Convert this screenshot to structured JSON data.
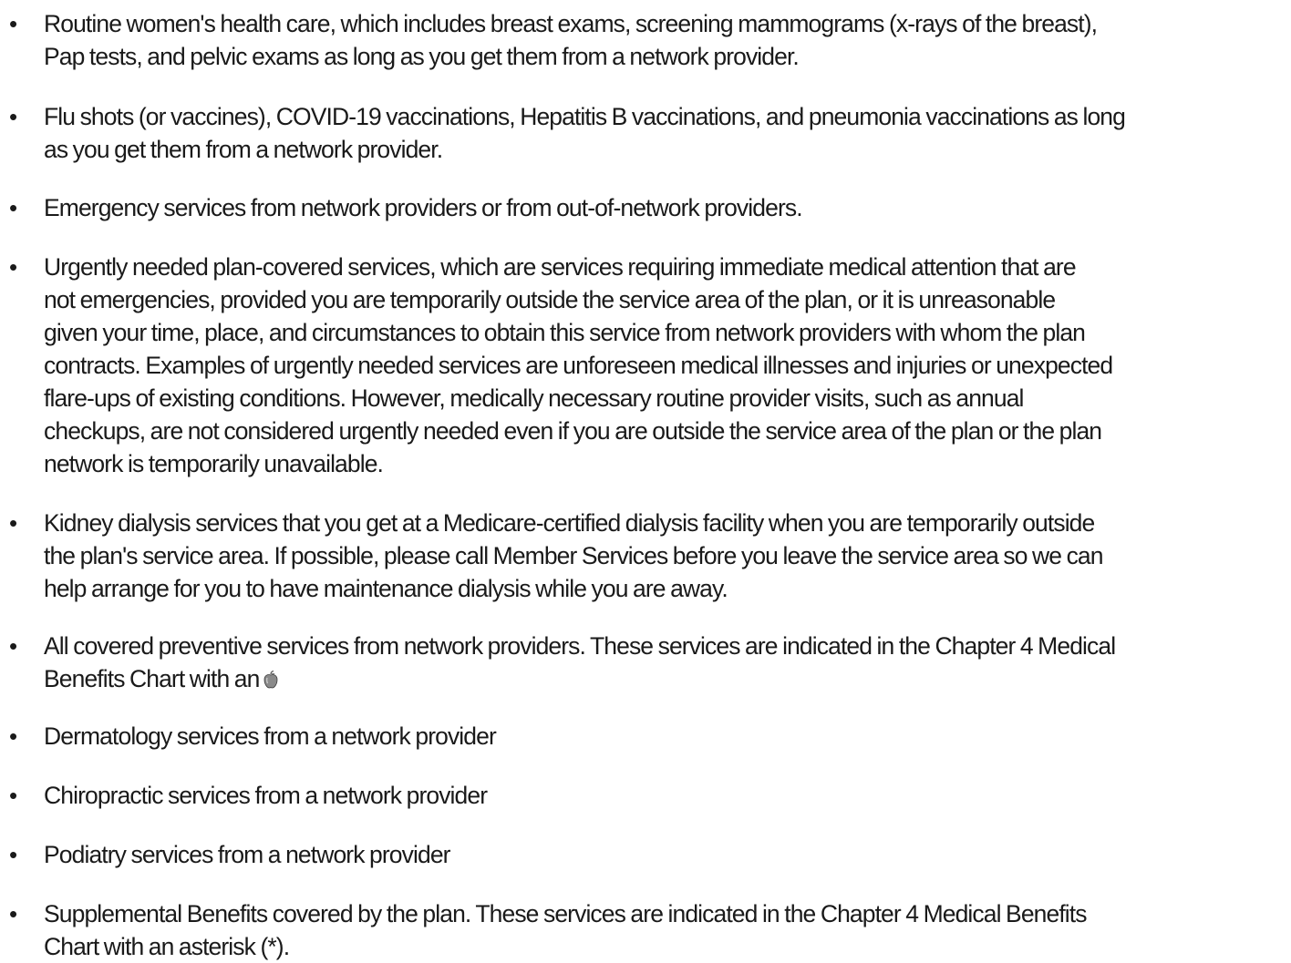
{
  "document": {
    "bullet_char": "•",
    "items": [
      {
        "text": "Routine women's health care, which includes breast exams, screening mammograms (x-rays of the breast),\nPap tests, and pelvic exams as long as you get them from a network provider."
      },
      {
        "text": "Flu shots (or vaccines), COVID-19 vaccinations, Hepatitis B vaccinations, and pneumonia vaccinations as long\nas you get them from a network provider."
      },
      {
        "text": "Emergency services from network providers or from out-of-network providers."
      },
      {
        "text": "Urgently needed plan-covered services, which are services requiring immediate medical attention that are\nnot emergencies, provided you are temporarily outside the service area of the plan, or it is unreasonable\ngiven your time, place, and circumstances to obtain this service from network providers with whom the plan\ncontracts. Examples of urgently needed services are unforeseen medical illnesses and injuries or unexpected\nflare-ups of existing conditions. However, medically necessary routine provider visits, such as annual\ncheckups, are not considered urgently needed even if you are outside the service area of the plan or the plan\nnetwork is temporarily unavailable."
      },
      {
        "text": "Kidney dialysis services that you get at a Medicare-certified dialysis facility when you are temporarily outside\nthe plan's service area. If possible, please call Member Services before you leave the service area so we can\nhelp arrange for you to have maintenance dialysis while you are away."
      },
      {
        "text": "All covered preventive services from network providers. These services are indicated in the Chapter 4 Medical\nBenefits Chart with an",
        "icon": "apple-icon"
      },
      {
        "text": "Dermatology services from a network provider"
      },
      {
        "text": "Chiropractic services from a network provider"
      },
      {
        "text": "Podiatry services from a network provider"
      },
      {
        "text": "Supplemental Benefits covered by the plan. These services are indicated in the Chapter 4 Medical Benefits\nChart with an asterisk (*)."
      }
    ]
  }
}
